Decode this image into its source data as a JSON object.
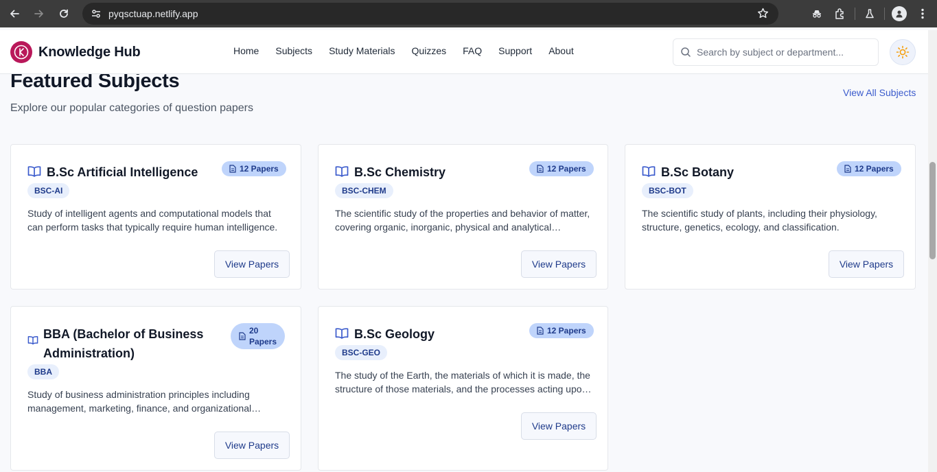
{
  "browser": {
    "url": "pyqsctuap.netlify.app"
  },
  "header": {
    "brand_name": "Knowledge Hub",
    "nav": [
      "Home",
      "Subjects",
      "Study Materials",
      "Quizzes",
      "FAQ",
      "Support",
      "About"
    ],
    "search_placeholder": "Search by subject or department..."
  },
  "section": {
    "title": "Featured Subjects",
    "subtitle": "Explore our popular categories of question papers",
    "view_all": "View All Subjects"
  },
  "cards": [
    {
      "title": "B.Sc Artificial Intelligence",
      "code": "BSC-AI",
      "papers": "12 Papers",
      "description": "Study of intelligent agents and computational models that can perform tasks that typically require human intelligence.",
      "button": "View Papers"
    },
    {
      "title": "B.Sc Chemistry",
      "code": "BSC-CHEM",
      "papers": "12 Papers",
      "description": "The scientific study of the properties and behavior of matter, covering organic, inorganic, physical and analytical chemistry.",
      "button": "View Papers"
    },
    {
      "title": "B.Sc Botany",
      "code": "BSC-BOT",
      "papers": "12 Papers",
      "description": "The scientific study of plants, including their physiology, structure, genetics, ecology, and classification.",
      "button": "View Papers"
    },
    {
      "title": "BBA (Bachelor of Business Administration)",
      "code": "BBA",
      "papers_line1": "20",
      "papers_line2": "Papers",
      "description": "Study of business administration principles including management, marketing, finance, and organizational behavior.",
      "button": "View Papers"
    },
    {
      "title": "B.Sc Geology",
      "code": "BSC-GEO",
      "papers": "12 Papers",
      "description": "The study of the Earth, the materials of which it is made, the structure of those materials, and the processes acting upon them.",
      "button": "View Papers"
    }
  ],
  "colors": {
    "accent": "#3b5bcc",
    "badge_bg": "#bfd4fb",
    "code_bg": "#e8effc",
    "logo": "#b9185a",
    "sun": "#f59e0b"
  },
  "icons": [
    "back-arrow-icon",
    "forward-arrow-icon",
    "reload-icon",
    "site-info-icon",
    "bookmark-star-icon",
    "incognito-icon",
    "extensions-icon",
    "labs-icon",
    "profile-icon",
    "kebab-menu-icon",
    "search-icon",
    "sun-icon",
    "book-icon",
    "document-icon"
  ]
}
